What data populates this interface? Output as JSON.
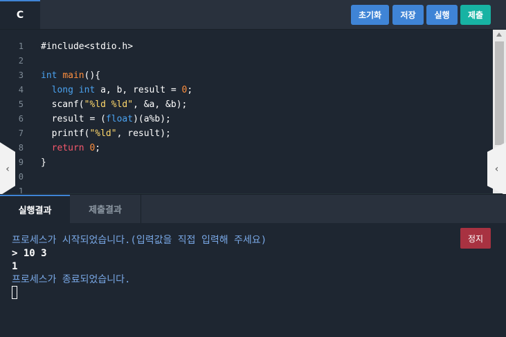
{
  "header": {
    "language_tab": "C",
    "buttons": {
      "reset": "초기화",
      "save": "저장",
      "run": "실행",
      "submit": "제출"
    }
  },
  "editor": {
    "line_numbers": [
      "1",
      "2",
      "3",
      "4",
      "5",
      "6",
      "7",
      "8",
      "9",
      "0",
      "1"
    ],
    "code_lines": [
      "#include<stdio.h>",
      "",
      "int main(){",
      "  long int a, b, result = 0;",
      "  scanf(\"%ld %ld\", &a, &b);",
      "  result = (float)(a%b);",
      "  printf(\"%ld\", result);",
      "  return 0;",
      "}",
      "",
      ""
    ],
    "side_handles": {
      "left": "‹",
      "right": "‹"
    }
  },
  "bottom_tabs": {
    "run_result": "실행결과",
    "submit_result": "제출결과"
  },
  "console": {
    "stop_button": "정지",
    "lines": [
      "프로세스가 시작되었습니다.(입력값을 직접 입력해 주세요)",
      "> 10 3",
      "1",
      "프로세스가 종료되었습니다."
    ]
  },
  "colors": {
    "primary_button": "#3f84d6",
    "submit_button": "#17b3a3",
    "stop_button": "#a83241",
    "keyword": "#4ba3f0",
    "string": "#ffd86b",
    "return_keyword": "#f5586c",
    "console_message": "#79a8e6"
  }
}
